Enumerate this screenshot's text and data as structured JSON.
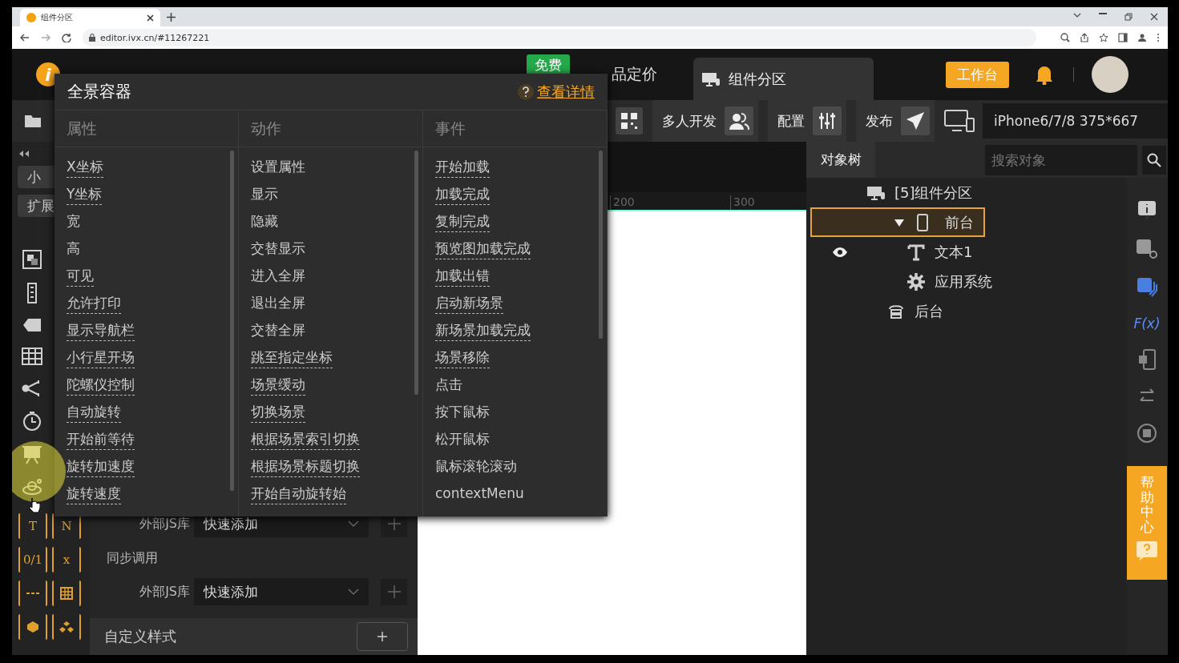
{
  "browser": {
    "tab_title": "组件分区",
    "address": "editor.ivx.cn/#11267221"
  },
  "header": {
    "logo_mark": "i",
    "badge": "免费",
    "nav_partial": "品定价",
    "doc_tab": "组件分区",
    "workbench_button": "工作台"
  },
  "toolbar": {
    "buttons": [
      {
        "label": "多人开发"
      },
      {
        "label": "配置"
      },
      {
        "label": "发布"
      }
    ],
    "device": "iPhone6/7/8 375*667"
  },
  "sidebar": {
    "tabs": [
      {
        "label": "小"
      },
      {
        "label": "扩展"
      }
    ],
    "tools": [
      {
        "kind": "text",
        "label": "T"
      },
      {
        "kind": "text",
        "label": "N"
      },
      {
        "kind": "text",
        "label": "0/1"
      },
      {
        "kind": "text",
        "label": "x"
      },
      {
        "kind": "dashes"
      },
      {
        "kind": "grid"
      },
      {
        "kind": "cube"
      },
      {
        "kind": "cubes"
      }
    ]
  },
  "props_panel": {
    "rows": [
      {
        "kind": "select",
        "label": "外部JS库",
        "value": "快速添加"
      },
      {
        "kind": "heading",
        "label": "同步调用"
      },
      {
        "kind": "select",
        "label": "外部JS库",
        "value": "快速添加"
      }
    ],
    "custom_style": "自定义样式"
  },
  "ruler": {
    "ticks": [
      "200",
      "300"
    ]
  },
  "object_tree": {
    "tab": "对象树",
    "search": {
      "placeholder": "搜索对象"
    },
    "nodes": [
      {
        "label": "[5]组件分区",
        "kind": "scene",
        "selected": false,
        "children": [
          {
            "label": "前台",
            "kind": "phone",
            "selected": true,
            "expanded": true,
            "children": [
              {
                "label": "文本1",
                "kind": "text",
                "selected": false,
                "visible": true
              },
              {
                "label": "应用系统",
                "kind": "gear",
                "selected": false,
                "visible": false
              }
            ]
          },
          {
            "label": "后台",
            "kind": "server",
            "selected": false
          }
        ]
      }
    ]
  },
  "function_label": "F(x)",
  "help": {
    "label": "帮助中心"
  },
  "popup": {
    "title": "全景容器",
    "help_link": "查看详情",
    "columns": [
      {
        "heading": "属性",
        "items": [
          {
            "label": "X坐标",
            "underlined": true
          },
          {
            "label": "Y坐标",
            "underlined": true
          },
          {
            "label": "宽",
            "underlined": false
          },
          {
            "label": "高",
            "underlined": false
          },
          {
            "label": "可见",
            "underlined": true
          },
          {
            "label": "允许打印",
            "underlined": true
          },
          {
            "label": "显示导航栏",
            "underlined": true
          },
          {
            "label": "小行星开场",
            "underlined": true
          },
          {
            "label": "陀螺仪控制",
            "underlined": true
          },
          {
            "label": "自动旋转",
            "underlined": true
          },
          {
            "label": "开始前等待",
            "underlined": true
          },
          {
            "label": "旋转加速度",
            "underlined": true
          },
          {
            "label": "旋转速度",
            "underlined": true
          }
        ]
      },
      {
        "heading": "动作",
        "items": [
          {
            "label": "设置属性",
            "underlined": false
          },
          {
            "label": "显示",
            "underlined": false
          },
          {
            "label": "隐藏",
            "underlined": false
          },
          {
            "label": "交替显示",
            "underlined": false
          },
          {
            "label": "进入全屏",
            "underlined": false
          },
          {
            "label": "退出全屏",
            "underlined": false
          },
          {
            "label": "交替全屏",
            "underlined": false
          },
          {
            "label": "跳至指定坐标",
            "underlined": true
          },
          {
            "label": "场景缓动",
            "underlined": true
          },
          {
            "label": "切换场景",
            "underlined": true
          },
          {
            "label": "根据场景索引切换",
            "underlined": true
          },
          {
            "label": "根据场景标题切换",
            "underlined": true
          },
          {
            "label": "开始自动旋转始",
            "underlined": true
          }
        ]
      },
      {
        "heading": "事件",
        "items": [
          {
            "label": "开始加载",
            "underlined": true
          },
          {
            "label": "加载完成",
            "underlined": true
          },
          {
            "label": "复制完成",
            "underlined": true
          },
          {
            "label": "预览图加载完成",
            "underlined": true
          },
          {
            "label": "加载出错",
            "underlined": true
          },
          {
            "label": "启动新场景",
            "underlined": true
          },
          {
            "label": "新场景加载完成",
            "underlined": true
          },
          {
            "label": "场景移除",
            "underlined": true
          },
          {
            "label": "点击",
            "underlined": false
          },
          {
            "label": "按下鼠标",
            "underlined": false
          },
          {
            "label": "松开鼠标",
            "underlined": false
          },
          {
            "label": "鼠标滚轮滚动",
            "underlined": false
          },
          {
            "label": "contextMenu",
            "underlined": false
          }
        ]
      }
    ]
  }
}
